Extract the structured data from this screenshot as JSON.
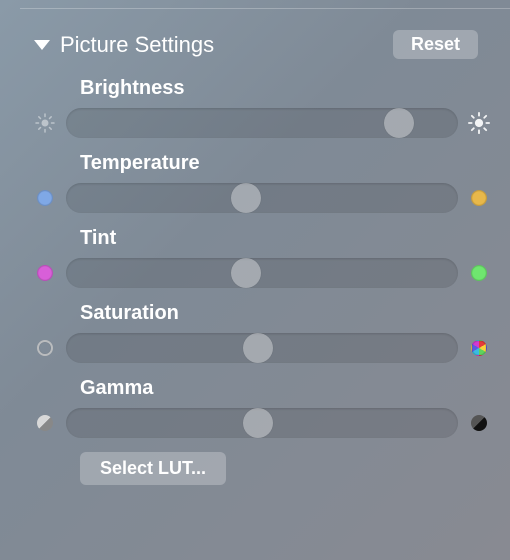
{
  "header": {
    "title": "Picture Settings",
    "reset_label": "Reset"
  },
  "controls": {
    "brightness": {
      "label": "Brightness",
      "value": 85
    },
    "temperature": {
      "label": "Temperature",
      "value": 46
    },
    "tint": {
      "label": "Tint",
      "value": 46
    },
    "saturation": {
      "label": "Saturation",
      "value": 49
    },
    "gamma": {
      "label": "Gamma",
      "value": 49
    }
  },
  "icons": {
    "brightness_low": "dim-sun-icon",
    "brightness_high": "bright-sun-icon",
    "temperature_cool": "#7fa8e6",
    "temperature_warm": "#e8b84a",
    "tint_magenta": "#d85fd8",
    "tint_green": "#6fe66f",
    "saturation_gray": "#bdbdbd",
    "saturation_color": "color-wheel",
    "gamma_light": "light-half",
    "gamma_dark": "dark-half"
  },
  "footer": {
    "lut_label": "Select LUT..."
  }
}
